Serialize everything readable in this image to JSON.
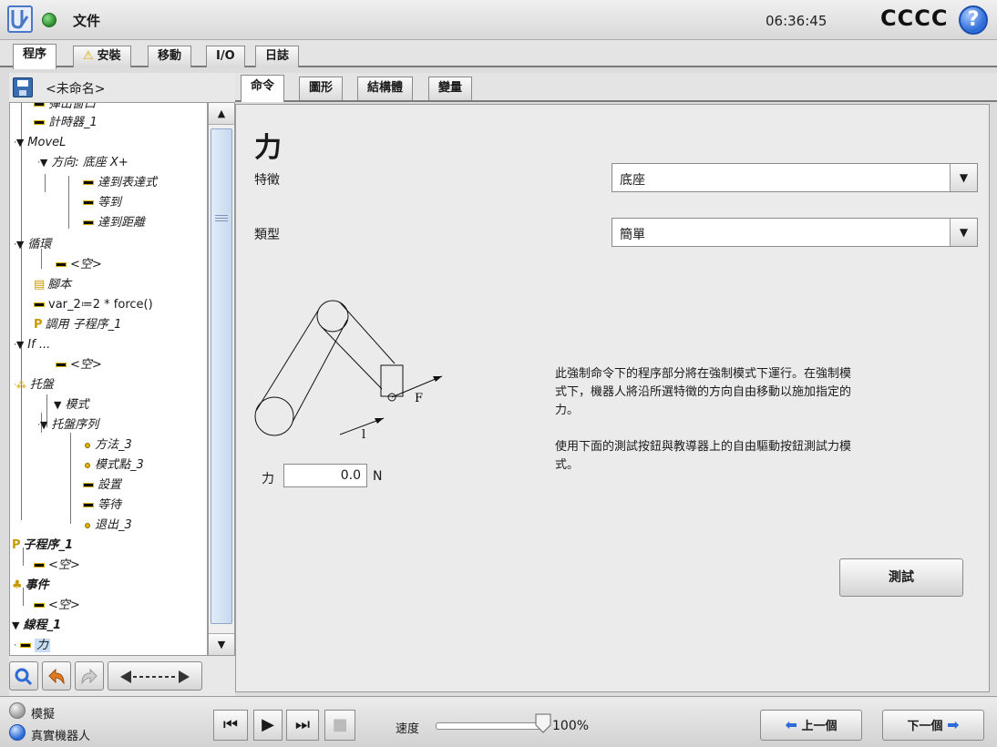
{
  "topbar": {
    "file_menu": "文件",
    "time": "06:36:45",
    "robot_name": "CCCC",
    "help": "?"
  },
  "main_tabs": [
    {
      "label": "程序",
      "active": true
    },
    {
      "label": "安裝",
      "warning": true
    },
    {
      "label": "移動"
    },
    {
      "label": "I/O"
    },
    {
      "label": "日誌"
    }
  ],
  "program": {
    "name": "<未命名>",
    "tree": [
      {
        "label": "彈出窗口",
        "icon": "bar"
      },
      {
        "label": "計時器_1",
        "icon": "bar"
      },
      {
        "label": "MoveL",
        "icon": "triangle"
      },
      {
        "label": "方向: 底座 X+",
        "icon": "triangle"
      },
      {
        "label": "達到表達式",
        "icon": "bar"
      },
      {
        "label": "等到",
        "icon": "bar"
      },
      {
        "label": "達到距離",
        "icon": "bar"
      },
      {
        "label": "循環",
        "icon": "triangle"
      },
      {
        "label": "<空>",
        "icon": "bar"
      },
      {
        "label": "腳本",
        "icon": "script"
      },
      {
        "label": "var_2≔2 * force()",
        "icon": "bar"
      },
      {
        "label": "調用 子程序_1",
        "icon": "p"
      },
      {
        "label": "If ...",
        "icon": "triangle"
      },
      {
        "label": "<空>",
        "icon": "bar"
      },
      {
        "label": "托盤",
        "icon": "pallet"
      },
      {
        "label": "模式",
        "icon": "triangle"
      },
      {
        "label": "托盤序列",
        "icon": "triangle"
      },
      {
        "label": "方法_3",
        "icon": "dot"
      },
      {
        "label": "模式點_3",
        "icon": "dot"
      },
      {
        "label": "設置",
        "icon": "bar"
      },
      {
        "label": "等待",
        "icon": "bar"
      },
      {
        "label": "退出_3",
        "icon": "dot"
      },
      {
        "label": "子程序_1",
        "icon": "p"
      },
      {
        "label": "<空>",
        "icon": "bar"
      },
      {
        "label": "事件",
        "icon": "event"
      },
      {
        "label": "<空>",
        "icon": "bar"
      },
      {
        "label": "線程_1",
        "icon": "triangle"
      },
      {
        "label": "力",
        "icon": "bar"
      }
    ]
  },
  "sub_tabs": [
    {
      "label": "命令",
      "active": true
    },
    {
      "label": "圖形"
    },
    {
      "label": "結構體"
    },
    {
      "label": "變量"
    }
  ],
  "force_node": {
    "title": "力",
    "feature_label": "特徵",
    "feature_value": "底座",
    "type_label": "類型",
    "type_value": "簡單",
    "diagram_F": "F",
    "diagram_l": "l",
    "force_label": "力",
    "force_value": "0.0",
    "force_unit": "N",
    "desc_1_line1": "此強制命令下的程序部分將在強制模式下運行。在強制模",
    "desc_1_line2": "式下，機器人將沿所選特徵的方向自由移動以施加指定的",
    "desc_1_line3": "力。",
    "desc_2_line1": "使用下面的測試按鈕與教導器上的自由驅動按鈕測試力模",
    "desc_2_line2": "式。",
    "test_button": "測試"
  },
  "bottombar": {
    "sim_label": "模擬",
    "real_label": "真實機器人",
    "speed_label": "速度",
    "speed_value": "100%",
    "speed_fraction": 1.0,
    "prev_label": "上一個",
    "next_label": "下一個"
  }
}
